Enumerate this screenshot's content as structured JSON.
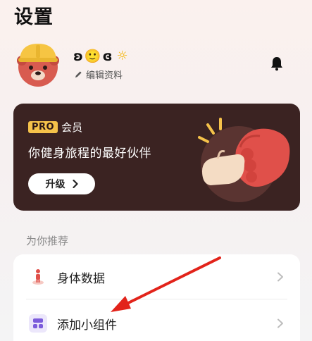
{
  "header": {
    "title": "设置"
  },
  "profile": {
    "name_left": "ʚ",
    "name_emoji": "🙂",
    "name_right": "ɞ",
    "name_suffix": "☼",
    "edit_label": "编辑资料",
    "avatar_icon": "bear-with-yellow-helmet-icon"
  },
  "notification": {
    "icon": "bell-icon"
  },
  "pro_card": {
    "badge": "PRO",
    "member_label": "会员",
    "tagline": "你健身旅程的最好伙伴",
    "upgrade_label": "升级",
    "upgrade_icon": "chevron-right-icon",
    "art": "fist-bump-illustration",
    "colors": {
      "background": "#3b2322",
      "badge": "#f5c24a",
      "fist": "#e0504a"
    }
  },
  "recommendations": {
    "section_title": "为你推荐",
    "items": [
      {
        "label": "身体数据",
        "icon": "body-figure-icon"
      },
      {
        "label": "添加小组件",
        "icon": "widget-grid-icon"
      }
    ]
  },
  "annotation": {
    "arrow_color": "#e2231a"
  }
}
